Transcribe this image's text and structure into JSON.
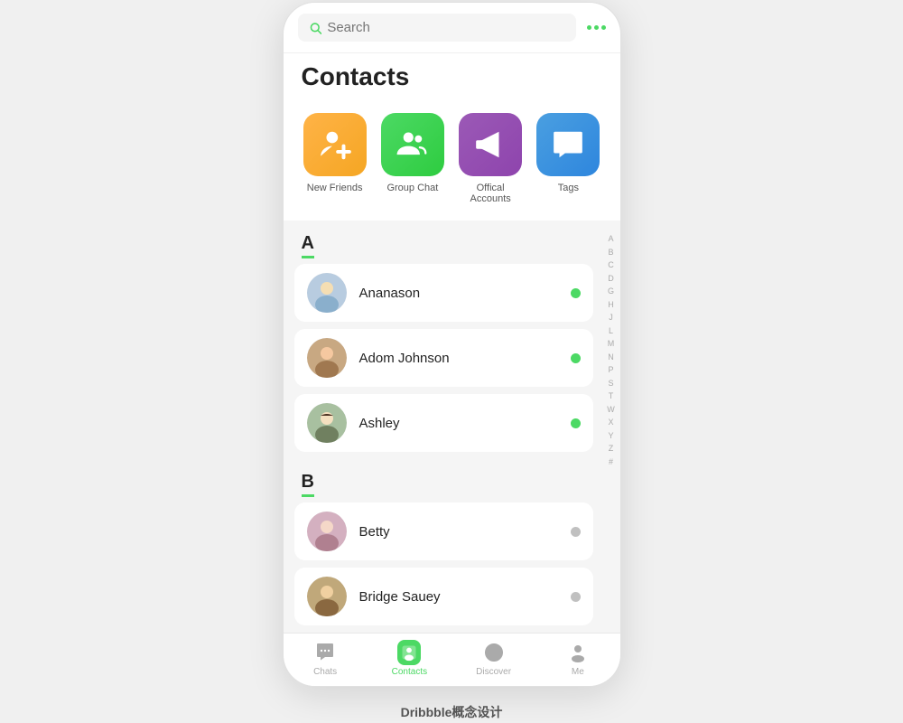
{
  "app": {
    "title": "Contacts",
    "footer": "Dribbble概念设计"
  },
  "search": {
    "placeholder": "Search"
  },
  "quick_actions": [
    {
      "id": "new-friends",
      "label": "New Friends",
      "color": "bg-orange",
      "icon": "person-add"
    },
    {
      "id": "group-chat",
      "label": "Group Chat",
      "color": "bg-green",
      "icon": "group"
    },
    {
      "id": "official-accounts",
      "label": "Offical Accounts",
      "color": "bg-purple",
      "icon": "megaphone"
    },
    {
      "id": "tags",
      "label": "Tags",
      "color": "bg-blue",
      "icon": "star-chat"
    }
  ],
  "sections": [
    {
      "letter": "A",
      "contacts": [
        {
          "name": "Ananason",
          "status": "online",
          "avatar_color": "#b0c4de"
        },
        {
          "name": "Adom Johnson",
          "status": "online",
          "avatar_color": "#c8a882"
        },
        {
          "name": "Ashley",
          "status": "online",
          "avatar_color": "#a0b89a"
        }
      ]
    },
    {
      "letter": "B",
      "contacts": [
        {
          "name": "Betty",
          "status": "offline",
          "avatar_color": "#d4b0c0"
        },
        {
          "name": "Bridge Sauey",
          "status": "offline",
          "avatar_color": "#c0a87a"
        }
      ]
    }
  ],
  "alphabet": [
    "A",
    "B",
    "C",
    "D",
    "G",
    "H",
    "J",
    "L",
    "M",
    "N",
    "P",
    "S",
    "T",
    "W",
    "X",
    "Y",
    "Z",
    "#"
  ],
  "bottom_nav": [
    {
      "id": "chats",
      "label": "Chats",
      "icon": "chat-bubble",
      "active": false
    },
    {
      "id": "contacts",
      "label": "Contacts",
      "icon": "contacts-book",
      "active": true
    },
    {
      "id": "discover",
      "label": "Discover",
      "icon": "compass",
      "active": false
    },
    {
      "id": "me",
      "label": "Me",
      "icon": "person",
      "active": false
    }
  ],
  "dots_menu": "..."
}
